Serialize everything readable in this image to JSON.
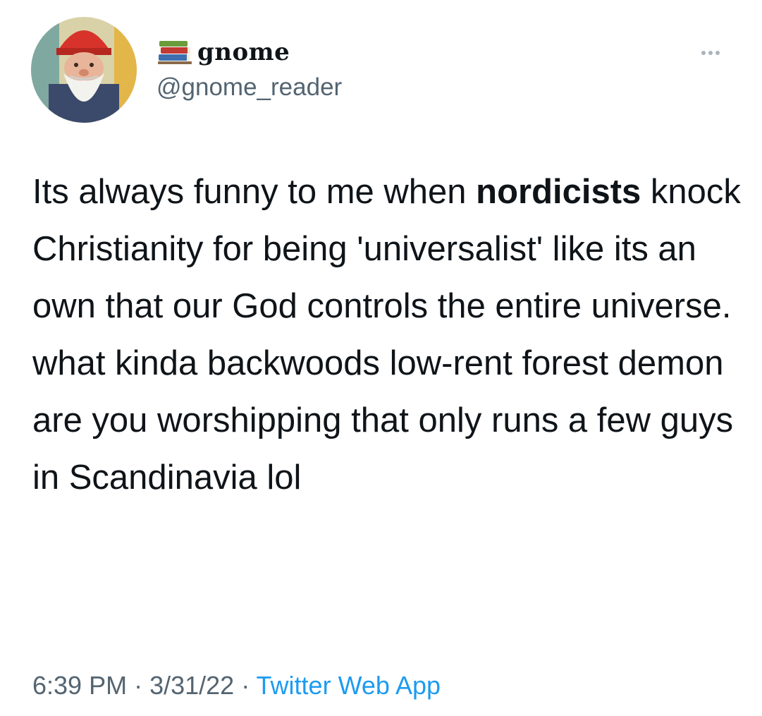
{
  "author": {
    "display_name": "gnome",
    "handle": "@gnome_reader",
    "avatar_icon": "gnome-avatar",
    "badge_icon": "books-icon"
  },
  "tweet": {
    "text_part_1": "Its always funny to me when ",
    "text_bold": "nordicists",
    "text_part_2": " knock Christianity for being 'universalist' like its an own that our God controls the entire universe. what kinda backwoods low-rent forest demon are you worshipping that only runs a few guys in Scandinavia lol"
  },
  "meta": {
    "time": "6:39 PM",
    "separator": " · ",
    "date": "3/31/22",
    "source": "Twitter Web App"
  },
  "colors": {
    "text": "#0f1419",
    "secondary": "#536471",
    "link": "#1d9bf0"
  }
}
